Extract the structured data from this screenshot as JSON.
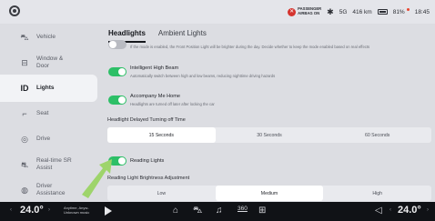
{
  "status": {
    "airbag_line1": "PASSENGER",
    "airbag_line2": "AIRBAG ON",
    "range": "416 km",
    "battery": "81%",
    "time": "18:45",
    "icons": [
      "bluetooth-icon",
      "signal-5g-icon",
      "battery-icon"
    ]
  },
  "sidebar": {
    "items": [
      {
        "label": "Vehicle",
        "icon": "car-icon"
      },
      {
        "label": "Window & Door",
        "icon": "window-door-icon"
      },
      {
        "label": "Lights",
        "icon": "lights-icon",
        "active": true
      },
      {
        "label": "Seat",
        "icon": "seat-icon"
      },
      {
        "label": "Drive",
        "icon": "steering-wheel-icon"
      },
      {
        "label": "Real-time SR Assist",
        "icon": "sr-assist-icon"
      },
      {
        "label": "Driver Assistance",
        "icon": "driver-assistance-icon"
      }
    ]
  },
  "tabs": [
    {
      "label": "Headlights",
      "active": true
    },
    {
      "label": "Ambient Lights",
      "active": false
    }
  ],
  "options": {
    "front_position_desc": "If the mode is enabled, the Front Position Light will be brighter during the day. Decide whether to keep the mode enabled based on real effects",
    "intelligent_high_beam": {
      "title": "Intelligent High Beam",
      "desc": "Automatically switch between high and low beams, reducing nighttime driving hazards",
      "enabled": true
    },
    "accompany_me_home": {
      "title": "Accompany Me Home",
      "desc": "Headlights are turned off later after locking the car",
      "enabled": true
    },
    "reading_lights": {
      "title": "Reading Lights",
      "enabled": true
    }
  },
  "headlight_delay": {
    "label": "Headlight Delayed Turning off Time",
    "options": [
      "15 Seconds",
      "30 Seconds",
      "60 Seconds"
    ],
    "selected": "15 Seconds"
  },
  "reading_brightness": {
    "label": "Reading Light Brightness Adjustment",
    "options": [
      "Low",
      "Medium",
      "High"
    ],
    "selected": "Medium"
  },
  "bottom": {
    "left_temp": "24.0°",
    "right_temp": "24.0°",
    "media_line1": "Anytime, Anyw..",
    "media_line2": "Unknown music",
    "view_360": "360"
  },
  "colors": {
    "toggle_on": "#2dbf67",
    "highlight_arrow": "#9ed46b",
    "airbag_badge": "#d5342f"
  }
}
